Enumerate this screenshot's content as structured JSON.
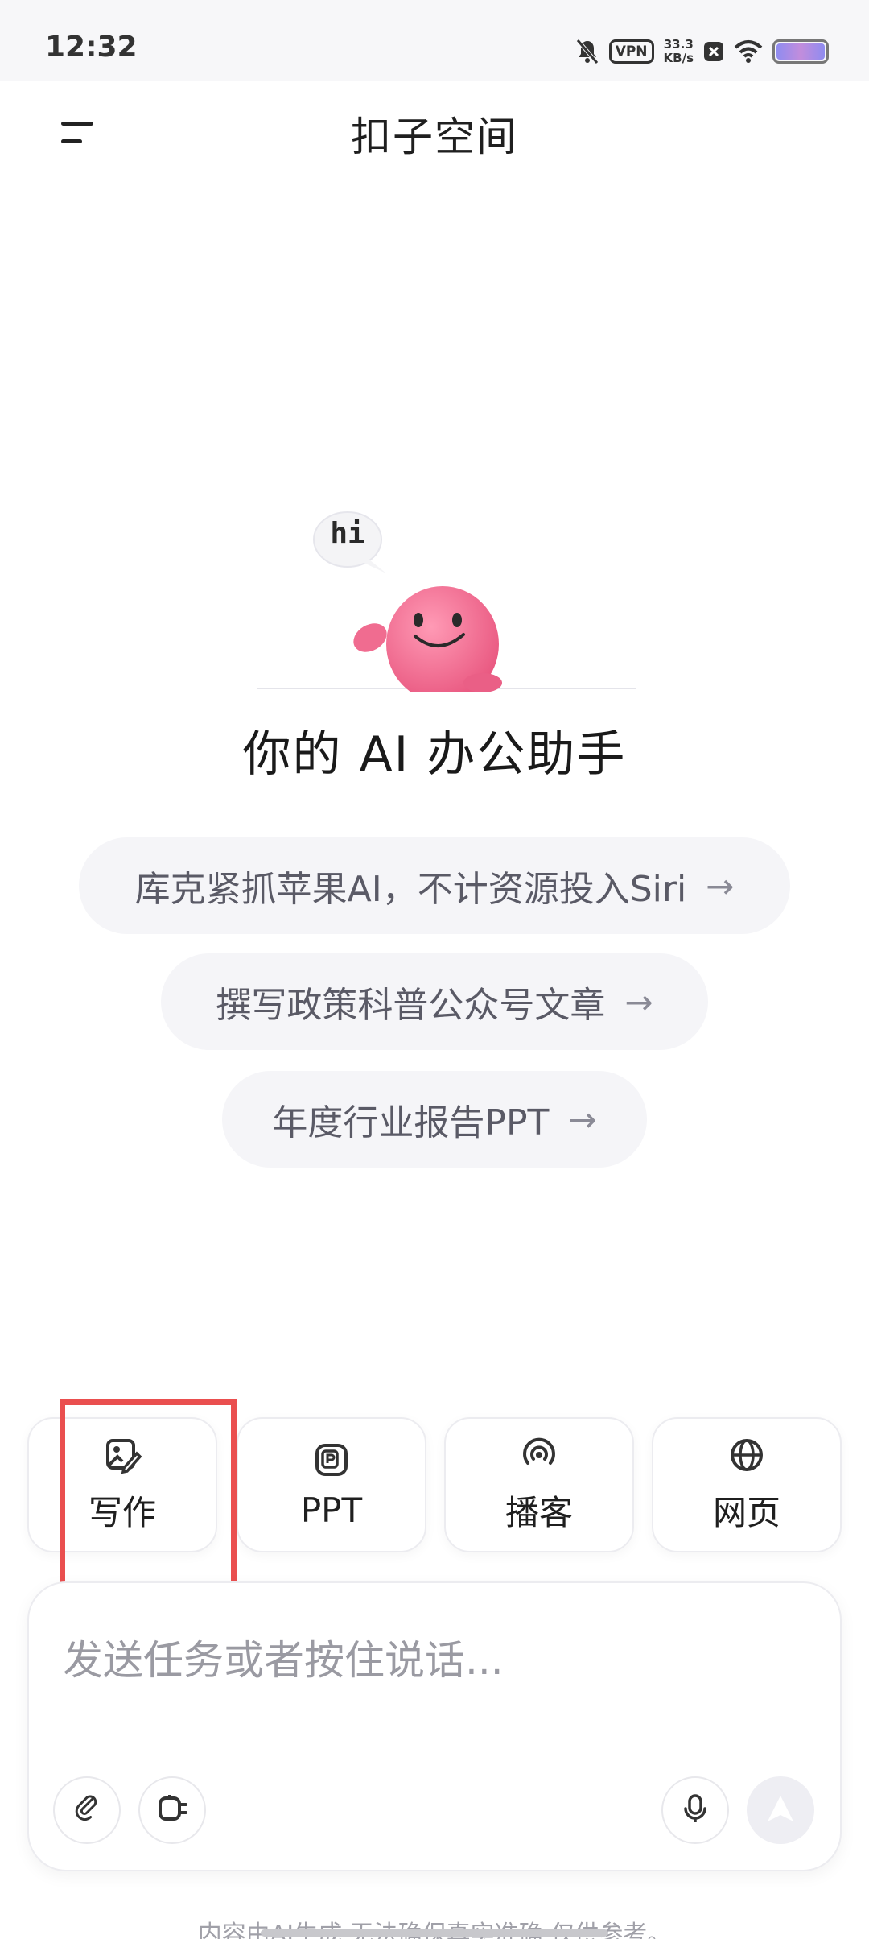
{
  "status_bar": {
    "time": "12:32",
    "vpn": "VPN",
    "speed_value": "33.3",
    "speed_unit": "KB/s",
    "icons": [
      "mute-bell-icon",
      "vpn-icon",
      "close-icon",
      "wifi-icon",
      "battery-icon"
    ]
  },
  "header": {
    "title": "扣子空间",
    "menu_icon": "menu-icon"
  },
  "hero": {
    "bubble_text": "hi",
    "subtitle": "你的 AI 办公助手"
  },
  "suggestions": [
    {
      "text": "库克紧抓苹果AI，不计资源投入Siri",
      "arrow": "→"
    },
    {
      "text": "撰写政策科普公众号文章",
      "arrow": "→"
    },
    {
      "text": "年度行业报告PPT",
      "arrow": "→"
    }
  ],
  "tools": [
    {
      "label": "写作",
      "icon": "write-image-icon"
    },
    {
      "label": "PPT",
      "icon": "ppt-icon"
    },
    {
      "label": "播客",
      "icon": "podcast-icon"
    },
    {
      "label": "网页",
      "icon": "globe-icon"
    }
  ],
  "input": {
    "placeholder": "发送任务或者按住说话...",
    "left_icons": [
      "attach-icon",
      "plugin-icon"
    ],
    "right_icons": [
      "microphone-icon",
      "send-icon"
    ]
  },
  "footer": {
    "disclaimer": "内容由AI生成,无法确保真实准确,仅供参考。"
  },
  "colors": {
    "highlight": "#ea4f4f",
    "mascot": "#f36b8e",
    "battery": "#9b8cf0"
  }
}
